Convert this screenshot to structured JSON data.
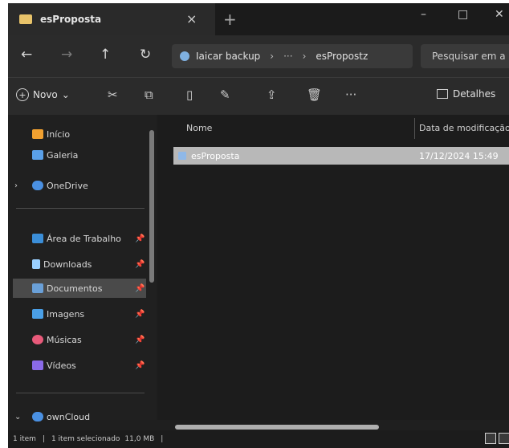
{
  "window": {
    "tab_title": "esProposta",
    "close_tab": "×",
    "new_tab": "+",
    "minimize": "–",
    "maximize": "□",
    "close": "✕"
  },
  "navigation": {
    "back": "←",
    "forward": "→",
    "up": "↑",
    "refresh": "↻"
  },
  "address": {
    "segment_1": "Iaicar backup",
    "sep_1": "›",
    "more": "···",
    "sep_2": "›",
    "segment_2": "esPropostz"
  },
  "search": {
    "placeholder": "Pesquisar em a"
  },
  "commandbar": {
    "new_plus": "+",
    "new_label": "Novo",
    "new_chevron": "⌄",
    "cut": "✂",
    "copy": "⧉",
    "paste": "▯",
    "rename": "✎",
    "share": "⇪",
    "delete": "🗑",
    "more": "···",
    "details": "Detalhes"
  },
  "sidebar": {
    "items": [
      {
        "label": "Início",
        "icon": "home-icon",
        "color": "#f0a030"
      },
      {
        "label": "Galeria",
        "icon": "gallery-icon",
        "color": "#5aa0e8"
      },
      {
        "label": "OneDrive",
        "icon": "cloud-icon",
        "color": "#4a90e2"
      },
      {
        "label": "Área de Trabalho",
        "icon": "desktop-icon",
        "color": "#3b8ed8"
      },
      {
        "label": "Downloads",
        "icon": "download-icon",
        "color": "#9ad0ff"
      },
      {
        "label": "Documentos",
        "icon": "documents-icon",
        "color": "#6aa0d8"
      },
      {
        "label": "Imagens",
        "icon": "images-icon",
        "color": "#4aa0e8"
      },
      {
        "label": "Músicas",
        "icon": "music-icon",
        "color": "#e85a7a"
      },
      {
        "label": "Vídeos",
        "icon": "videos-icon",
        "color": "#8a6ae8"
      },
      {
        "label": "ownCloud",
        "icon": "cloud-icon",
        "color": "#4a90e2"
      }
    ],
    "chevron_right": "›",
    "chevron_down": "⌄",
    "pin": "📌"
  },
  "content": {
    "columns": {
      "name": "Nome",
      "date": "Data de modificação"
    },
    "rows": [
      {
        "name": "esProposta",
        "date": "17/12/2024 15:49"
      }
    ]
  },
  "statusbar": {
    "items_count": "1 item",
    "sep": "|",
    "selected": "1 item selecionado",
    "size": "11,0 MB",
    "sep_2": "|"
  }
}
